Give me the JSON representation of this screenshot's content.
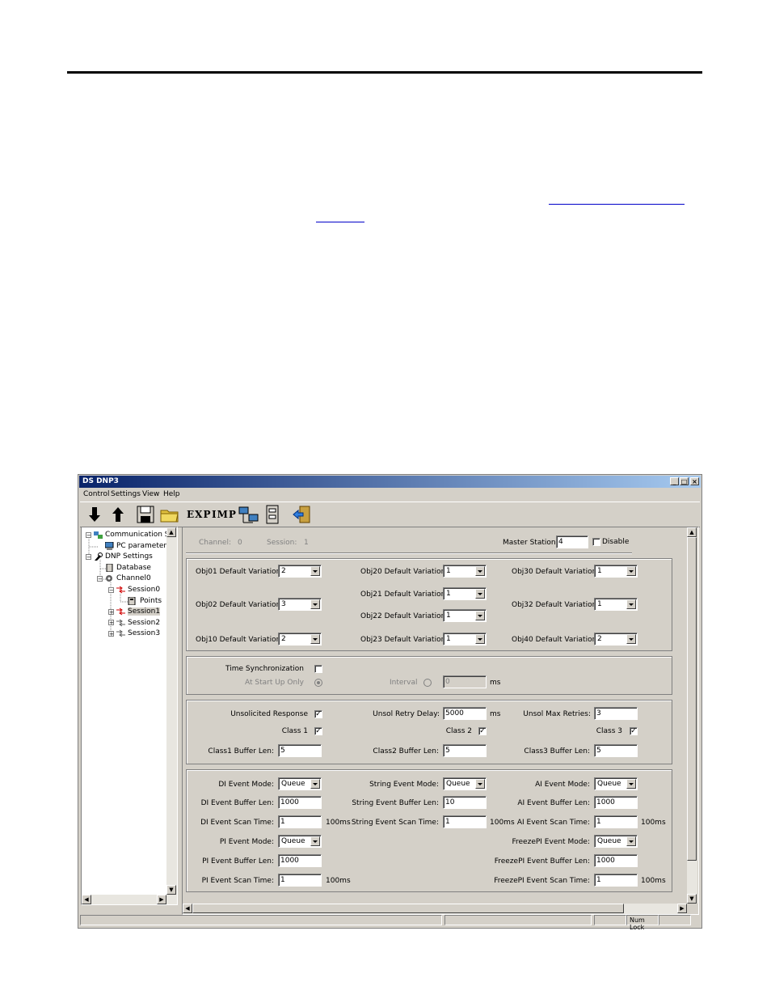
{
  "window": {
    "title": "DS DNP3",
    "min": "_",
    "max": "□",
    "close": "×"
  },
  "menu": [
    "Control",
    "Settings",
    "View",
    "Help"
  ],
  "toolbar": {
    "exp_label": "EXP",
    "imp_label": "IMP",
    "icons": [
      "download-arrow-icon",
      "upload-arrow-icon",
      "save-disk-icon",
      "open-folder-icon",
      "network-computers-icon",
      "database-icon",
      "exit-door-icon"
    ]
  },
  "tree": [
    {
      "label": "Communication S",
      "icon": "network-icon"
    },
    {
      "label": "PC parameter",
      "icon": "computer-icon"
    },
    {
      "label": "DNP Settings",
      "icon": "tools-icon"
    },
    {
      "label": "Database",
      "icon": "database-icon"
    },
    {
      "label": "Channel0",
      "icon": "gear-icon"
    },
    {
      "label": "Session0",
      "icon": "session-red-icon"
    },
    {
      "label": "Points",
      "icon": "points-icon"
    },
    {
      "label": "Session1",
      "icon": "session-red-icon"
    },
    {
      "label": "Session2",
      "icon": "session-gray-icon"
    },
    {
      "label": "Session3",
      "icon": "session-gray-icon"
    }
  ],
  "header": {
    "channel_label": "Channel:",
    "channel_value": "0",
    "session_label": "Session:",
    "session_value": "1",
    "master_label": "Master Station:",
    "master_value": "4",
    "disable_label": "Disable"
  },
  "variations": {
    "obj01": {
      "label": "Obj01 Default Variation:",
      "value": "2"
    },
    "obj02": {
      "label": "Obj02 Default Variation:",
      "value": "3"
    },
    "obj10": {
      "label": "Obj10 Default Variation:",
      "value": "2"
    },
    "obj20": {
      "label": "Obj20 Default Variation:",
      "value": "1"
    },
    "obj21": {
      "label": "Obj21 Default Variation:",
      "value": "1"
    },
    "obj22": {
      "label": "Obj22 Default Variation:",
      "value": "1"
    },
    "obj23": {
      "label": "Obj23 Default Variation:",
      "value": "1"
    },
    "obj30": {
      "label": "Obj30 Default Variation:",
      "value": "1"
    },
    "obj32": {
      "label": "Obj32 Default Variation:",
      "value": "1"
    },
    "obj40": {
      "label": "Obj40 Default Variation:",
      "value": "2"
    }
  },
  "timesync": {
    "label": "Time Synchronization",
    "startup_label": "At Start Up Only",
    "interval_label": "Interval",
    "interval_value": "0",
    "unit": "ms"
  },
  "unsol": {
    "response_label": "Unsolicited Response",
    "retry_label": "Unsol Retry Delay:",
    "retry_value": "5000",
    "retry_unit": "ms",
    "max_label": "Unsol Max Retries:",
    "max_value": "3",
    "class1_label": "Class 1",
    "class2_label": "Class 2",
    "class3_label": "Class 3",
    "buf1_label": "Class1 Buffer Len:",
    "buf1_value": "5",
    "buf2_label": "Class2 Buffer Len:",
    "buf2_value": "5",
    "buf3_label": "Class3 Buffer Len:",
    "buf3_value": "5"
  },
  "events": {
    "di_mode_label": "DI Event Mode:",
    "di_mode": "Queue",
    "di_buf_label": "DI Event Buffer Len:",
    "di_buf": "1000",
    "di_scan_label": "DI Event Scan Time:",
    "di_scan": "1",
    "di_scan_unit": "100ms",
    "str_mode_label": "String Event Mode:",
    "str_mode": "Queue",
    "str_buf_label": "String Event Buffer Len:",
    "str_buf": "10",
    "str_scan_label": "String Event Scan Time:",
    "str_scan": "1",
    "str_scan_unit": "100ms",
    "ai_mode_label": "AI Event Mode:",
    "ai_mode": "Queue",
    "ai_buf_label": "AI Event Buffer Len:",
    "ai_buf": "1000",
    "ai_scan_label": "AI Event Scan Time:",
    "ai_scan": "1",
    "ai_scan_unit": "100ms",
    "pi_mode_label": "PI Event Mode:",
    "pi_mode": "Queue",
    "pi_buf_label": "PI Event Buffer Len:",
    "pi_buf": "1000",
    "pi_scan_label": "PI Event Scan Time:",
    "pi_scan": "1",
    "pi_scan_unit": "100ms",
    "fpi_mode_label": "FreezePI Event Mode:",
    "fpi_mode": "Queue",
    "fpi_buf_label": "FreezePI Event Buffer Len:",
    "fpi_buf": "1000",
    "fpi_scan_label": "FreezePI Event Scan Time:",
    "fpi_scan": "1",
    "fpi_scan_unit": "100ms"
  },
  "status": {
    "numlock": "Num Lock"
  }
}
